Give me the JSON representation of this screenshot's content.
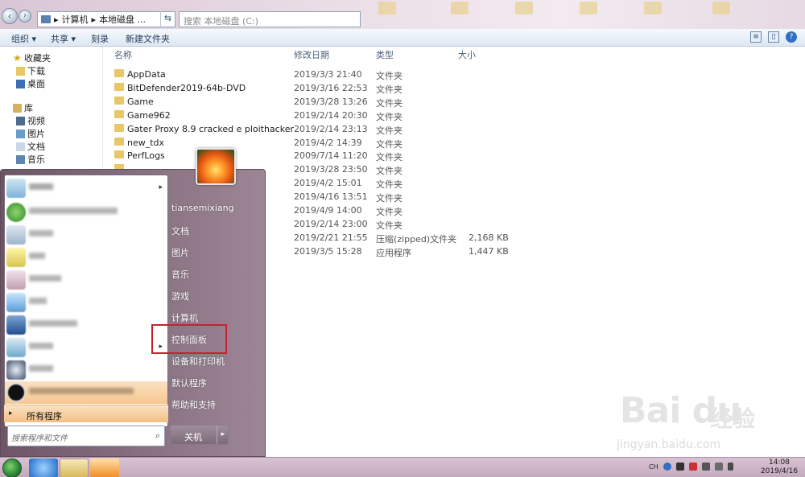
{
  "explorer": {
    "address": {
      "arrow": "▸",
      "path": [
        "计算机",
        "本地磁盘 ..."
      ],
      "sep": "▸"
    },
    "search_placeholder": "搜索 本地磁盘 (C:)",
    "toolbar": {
      "organize": "组织",
      "share": "共享",
      "burn": "刻录",
      "new_folder": "新建文件夹",
      "dropdown": "▾"
    },
    "nav": {
      "favorites": "收藏夹",
      "downloads": "下载",
      "desktop": "桌面",
      "libraries": "库",
      "videos": "视频",
      "pictures": "图片",
      "documents": "文档",
      "music": "音乐"
    },
    "columns": {
      "name": "名称",
      "date": "修改日期",
      "type": "类型",
      "size": "大小"
    },
    "files": [
      {
        "name": "AppData",
        "date": "2019/3/3 21:40",
        "type": "文件夹",
        "size": ""
      },
      {
        "name": "BitDefender2019-64b-DVD",
        "date": "2019/3/16 22:53",
        "type": "文件夹",
        "size": ""
      },
      {
        "name": "Game",
        "date": "2019/3/28 13:26",
        "type": "文件夹",
        "size": ""
      },
      {
        "name": "Game962",
        "date": "2019/2/14 20:30",
        "type": "文件夹",
        "size": ""
      },
      {
        "name": "Gater Proxy 8.9 cracked e ploithacker",
        "date": "2019/2/14 23:13",
        "type": "文件夹",
        "size": ""
      },
      {
        "name": "new_tdx",
        "date": "2019/4/2 14:39",
        "type": "文件夹",
        "size": ""
      },
      {
        "name": "PerfLogs",
        "date": "2009/7/14 11:20",
        "type": "文件夹",
        "size": ""
      },
      {
        "name": "",
        "date": "2019/3/28 23:50",
        "type": "文件夹",
        "size": ""
      },
      {
        "name": "",
        "date": "2019/4/2 15:01",
        "type": "文件夹",
        "size": ""
      },
      {
        "name": "",
        "date": "2019/4/16 13:51",
        "type": "文件夹",
        "size": ""
      },
      {
        "name": "",
        "date": "2019/4/9 14:00",
        "type": "文件夹",
        "size": ""
      },
      {
        "name": "",
        "date": "2019/2/14 23:00",
        "type": "文件夹",
        "size": ""
      },
      {
        "name": "",
        "date": "2019/2/21 21:55",
        "type": "压缩(zipped)文件夹",
        "size": "2,168 KB"
      },
      {
        "name": "",
        "date": "2019/3/5 15:28",
        "type": "应用程序",
        "size": "1,447 KB"
      }
    ]
  },
  "start_menu": {
    "all_programs": "所有程序",
    "search_placeholder": "搜索程序和文件",
    "user_name": "tiansemixiang",
    "right_items": [
      "文档",
      "图片",
      "音乐",
      "游戏",
      "计算机",
      "控制面板",
      "设备和打印机",
      "默认程序",
      "帮助和支持"
    ],
    "shutdown": "关机",
    "arrow": "▸",
    "search_glyph": "⌕",
    "highlight_color": "#cc1f2d"
  },
  "taskbar": {
    "lang": "CH",
    "time": "14:08",
    "date": "2019/4/16"
  },
  "watermark": {
    "brand": "Bai du",
    "brand_cn": "经验",
    "url": "jingyan.baidu.com"
  }
}
